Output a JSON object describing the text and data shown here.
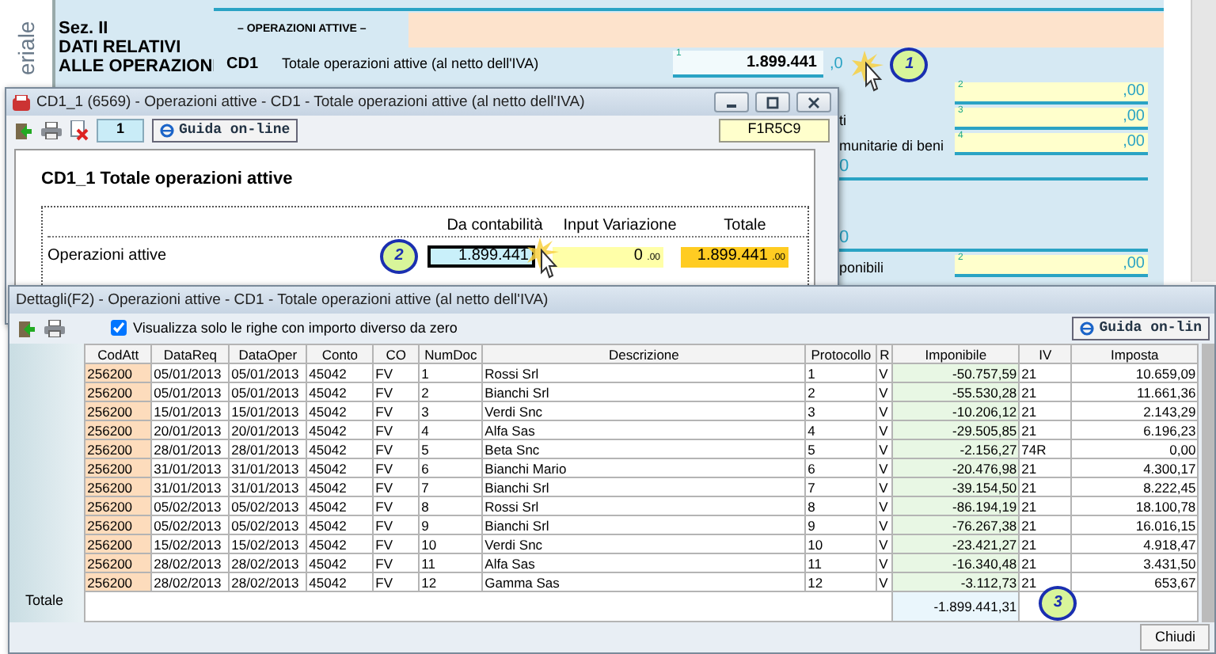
{
  "background_form": {
    "side_label": "eriale",
    "section": "Sez. II",
    "section_title": [
      "DATI RELATIVI",
      "ALLE OPERAZIONI"
    ],
    "group_title": "– OPERAZIONI ATTIVE –",
    "row": {
      "code": "CD1",
      "label": "Totale operazioni attive (al netto dell'IVA)",
      "index": "1",
      "value": "1.899.441",
      "decimals": ",0",
      "callout": "1"
    },
    "side_rows": [
      {
        "kind": "field",
        "index": "2",
        "decimals": ",00"
      },
      {
        "kind": "field",
        "label": "ti",
        "index": "3",
        "decimals": ",00"
      },
      {
        "kind": "field",
        "label": "munitarie di beni",
        "index": "4",
        "decimals": ",00"
      },
      {
        "kind": "total",
        "value": "0"
      },
      {
        "kind": "total",
        "value": "0"
      },
      {
        "kind": "field",
        "label": "ponibili",
        "index": "2",
        "decimals": ",00"
      }
    ]
  },
  "form_window": {
    "title": "CD1_1 (6569) - Operazioni attive - CD1 - Totale operazioni attive (al netto dell'IVA)",
    "page": "1",
    "help_button": "Guida on-line",
    "cell_ref": "F1R5C9",
    "heading": "CD1_1 Totale operazioni attive",
    "columns": [
      "Da  contabilità",
      "Input Variazione",
      "Totale"
    ],
    "row": {
      "label": "Operazioni attive",
      "callout": "2",
      "accounting": "1.899.441",
      "variation": "0",
      "variation_decimals": ".00",
      "total": "1.899.441",
      "total_decimals": ".00"
    }
  },
  "details_window": {
    "title": "Dettagli(F2) - Operazioni attive - CD1 - Totale operazioni attive (al netto dell'IVA)",
    "filter": {
      "label": "Visualizza solo le righe con importo diverso da zero",
      "checked": true
    },
    "help_button": "Guida on-lin",
    "columns": [
      "CodAtt",
      "DataReq",
      "DataOper",
      "Conto",
      "CO",
      "NumDoc",
      "Descrizione",
      "Protocollo",
      "R",
      "Imponibile",
      "IV",
      "Imposta"
    ],
    "rows": [
      [
        "256200",
        "05/01/2013",
        "05/01/2013",
        "45042",
        "FV",
        "1",
        "Rossi Srl",
        "1",
        "V",
        "-50.757,59",
        "21",
        "10.659,09"
      ],
      [
        "256200",
        "05/01/2013",
        "05/01/2013",
        "45042",
        "FV",
        "2",
        "Bianchi Srl",
        "2",
        "V",
        "-55.530,28",
        "21",
        "11.661,36"
      ],
      [
        "256200",
        "15/01/2013",
        "15/01/2013",
        "45042",
        "FV",
        "3",
        "Verdi Snc",
        "3",
        "V",
        "-10.206,12",
        "21",
        "2.143,29"
      ],
      [
        "256200",
        "20/01/2013",
        "20/01/2013",
        "45042",
        "FV",
        "4",
        "Alfa Sas",
        "4",
        "V",
        "-29.505,85",
        "21",
        "6.196,23"
      ],
      [
        "256200",
        "28/01/2013",
        "28/01/2013",
        "45042",
        "FV",
        "5",
        "Beta Snc",
        "5",
        "V",
        "-2.156,27",
        "74R",
        "0,00"
      ],
      [
        "256200",
        "31/01/2013",
        "31/01/2013",
        "45042",
        "FV",
        "6",
        "Bianchi Mario",
        "6",
        "V",
        "-20.476,98",
        "21",
        "4.300,17"
      ],
      [
        "256200",
        "31/01/2013",
        "31/01/2013",
        "45042",
        "FV",
        "7",
        "Bianchi Srl",
        "7",
        "V",
        "-39.154,50",
        "21",
        "8.222,45"
      ],
      [
        "256200",
        "05/02/2013",
        "05/02/2013",
        "45042",
        "FV",
        "8",
        "Rossi Srl",
        "8",
        "V",
        "-86.194,19",
        "21",
        "18.100,78"
      ],
      [
        "256200",
        "05/02/2013",
        "05/02/2013",
        "45042",
        "FV",
        "9",
        "Bianchi Srl",
        "9",
        "V",
        "-76.267,38",
        "21",
        "16.016,15"
      ],
      [
        "256200",
        "15/02/2013",
        "15/02/2013",
        "45042",
        "FV",
        "10",
        "Verdi Snc",
        "10",
        "V",
        "-23.421,27",
        "21",
        "4.918,47"
      ],
      [
        "256200",
        "28/02/2013",
        "28/02/2013",
        "45042",
        "FV",
        "11",
        "Alfa Sas",
        "11",
        "V",
        "-16.340,48",
        "21",
        "3.431,50"
      ],
      [
        "256200",
        "28/02/2013",
        "28/02/2013",
        "45042",
        "FV",
        "12",
        "Gamma Sas",
        "12",
        "V",
        "-3.112,73",
        "21",
        "653,67"
      ]
    ],
    "total_label": "Totale",
    "total_imponibile": "-1.899.441,31",
    "callout": "3",
    "close_button": "Chiudi"
  }
}
